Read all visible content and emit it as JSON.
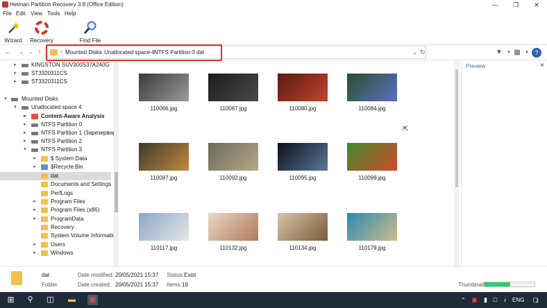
{
  "window": {
    "title": "Hetman Partition Recovery 3.9 (Office Edition)"
  },
  "menu": [
    "File",
    "Edit",
    "View",
    "Tools",
    "Help"
  ],
  "toolbar": {
    "wizard": "Wizard",
    "recovery": "Recovery",
    "find_file": "Find File"
  },
  "breadcrumb": [
    "Mounted Disks",
    "Unallocated space 4",
    "NTFS Partition 3",
    "dat"
  ],
  "tree": [
    {
      "label": "KINGSTON SUV300S37A240G",
      "icon": "drive-icon"
    },
    {
      "label": "ST3320311CS",
      "icon": "drive-icon"
    },
    {
      "label": "ST3320311CS",
      "icon": "drive-icon"
    },
    {
      "label": "Mounted Disks",
      "icon": "drive-icon"
    },
    {
      "label": "Unallocated space 4",
      "icon": "drive-icon"
    },
    {
      "label": "Content-Aware Analysis",
      "icon": "analysis-icon"
    },
    {
      "label": "NTFS Partition 0",
      "icon": "drive-icon"
    },
    {
      "label": "NTFS Partition 1 (Зарезервиров",
      "icon": "drive-icon"
    },
    {
      "label": "NTFS Partition 2",
      "icon": "drive-icon"
    },
    {
      "label": "NTFS Partition 3",
      "icon": "drive-icon"
    },
    {
      "label": "$ System Data",
      "icon": "folder-icon"
    },
    {
      "label": "$Recycle.Bin",
      "icon": "recycle-bin-icon"
    },
    {
      "label": "dat",
      "icon": "folder-icon"
    },
    {
      "label": "Documents and Settings",
      "icon": "folder-icon"
    },
    {
      "label": "PerfLogs",
      "icon": "folder-icon"
    },
    {
      "label": "Program Files",
      "icon": "folder-icon"
    },
    {
      "label": "Program Files (x86)",
      "icon": "folder-icon"
    },
    {
      "label": "ProgramData",
      "icon": "folder-icon"
    },
    {
      "label": "Recovery",
      "icon": "folder-icon"
    },
    {
      "label": "System Volume Information",
      "icon": "folder-icon"
    },
    {
      "label": "Users",
      "icon": "folder-icon"
    },
    {
      "label": "Windows",
      "icon": "folder-icon"
    }
  ],
  "files": [
    {
      "name": "110066.jpg",
      "colors": [
        "#3a3a3a",
        "#9a9a9a"
      ]
    },
    {
      "name": "110067.jpg",
      "colors": [
        "#1c1c1c",
        "#4a4a4a"
      ]
    },
    {
      "name": "110080.jpg",
      "colors": [
        "#5a1a12",
        "#c2452c"
      ]
    },
    {
      "name": "110084.jpg",
      "colors": [
        "#2a4f2a",
        "#5b6fc8"
      ]
    },
    {
      "name": "110087.jpg",
      "colors": [
        "#3d3a2a",
        "#c08a3e"
      ]
    },
    {
      "name": "110092.jpg",
      "colors": [
        "#6a6a5a",
        "#b8a88a"
      ]
    },
    {
      "name": "110095.jpg",
      "colors": [
        "#0d0d1a",
        "#5a7a9a"
      ]
    },
    {
      "name": "110099.jpg",
      "colors": [
        "#3e8a2e",
        "#d24a2a"
      ]
    },
    {
      "name": "110117.jpg",
      "colors": [
        "#8aa6c8",
        "#e6e6e6"
      ]
    },
    {
      "name": "110132.jpg",
      "colors": [
        "#e8d8c8",
        "#b07a5a"
      ]
    },
    {
      "name": "110134.jpg",
      "colors": [
        "#d8c4a8",
        "#7a5a3a"
      ]
    },
    {
      "name": "110179.jpg",
      "colors": [
        "#2a8ab0",
        "#cdbd8a"
      ]
    }
  ],
  "preview": {
    "title": "Preview"
  },
  "status": {
    "name": "dat",
    "type": "Folder",
    "modified_label": "Date modified:",
    "modified": "20/05/2021 15:37",
    "created_label": "Date created:",
    "created": "20/05/2021 15:37",
    "status_label": "Status:",
    "status": "Exist",
    "items_label": "Items:",
    "items": "19",
    "thumbnails_label": "Thumbnails",
    "thumbnails_progress": 0.52
  },
  "taskbar": {
    "lang": "ENG",
    "badge": "2"
  }
}
